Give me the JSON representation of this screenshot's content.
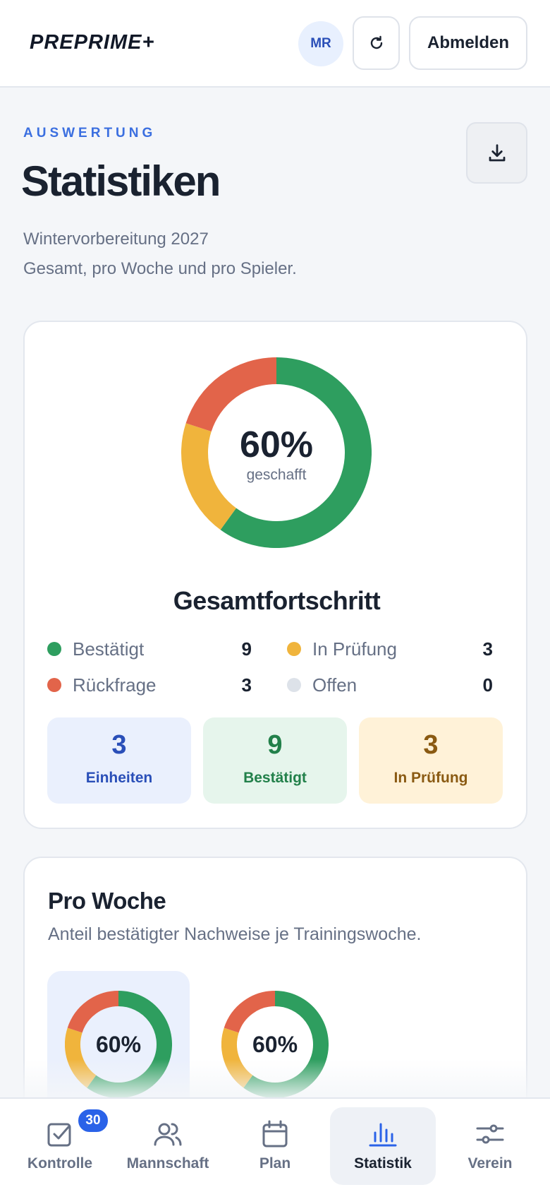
{
  "header": {
    "logo": "PREPRIME+",
    "avatar_initials": "MR",
    "refresh_icon": "refresh-icon",
    "logout_label": "Abmelden"
  },
  "page": {
    "eyebrow": "AUSWERTUNG",
    "title": "Statistiken",
    "subtitle_line1": "Wintervorbereitung 2027",
    "subtitle_line2": "Gesamt, pro Woche und pro Spieler.",
    "download_icon": "download-icon"
  },
  "total": {
    "percent": "60%",
    "percent_label": "geschafft",
    "title": "Gesamtfortschritt",
    "legend": [
      {
        "label": "Bestätigt",
        "count": "9",
        "color": "#2e9e5f"
      },
      {
        "label": "In Prüfung",
        "count": "3",
        "color": "#f0b43c"
      },
      {
        "label": "Rückfrage",
        "count": "3",
        "color": "#e2644a"
      },
      {
        "label": "Offen",
        "count": "0",
        "color": "#dde2e9"
      }
    ],
    "stats": [
      {
        "value": "3",
        "label": "Einheiten",
        "bg": "#eaf0fd",
        "color": "#2a4fb8"
      },
      {
        "value": "9",
        "label": "Bestätigt",
        "bg": "#e6f5ec",
        "color": "#22804a"
      },
      {
        "value": "3",
        "label": "In Prüfung",
        "bg": "#fff2d8",
        "color": "#8a5a12"
      }
    ]
  },
  "chart_data": {
    "type": "pie",
    "categories": [
      "Bestätigt",
      "In Prüfung",
      "Rückfrage",
      "Offen"
    ],
    "values": [
      9,
      3,
      3,
      0
    ],
    "colors": [
      "#2e9e5f",
      "#f0b43c",
      "#e2644a",
      "#dde2e9"
    ],
    "title": "Gesamtfortschritt"
  },
  "weekly": {
    "title": "Pro Woche",
    "description": "Anteil bestätigter Nachweise je Trainingswoche.",
    "weeks": [
      {
        "percent": "60%",
        "values": [
          9,
          3,
          3,
          0
        ]
      },
      {
        "percent": "60%",
        "values": [
          9,
          3,
          3,
          0
        ]
      }
    ]
  },
  "nav": {
    "items": [
      {
        "label": "Kontrolle",
        "icon": "checkbox-icon",
        "badge": "30"
      },
      {
        "label": "Mannschaft",
        "icon": "users-icon"
      },
      {
        "label": "Plan",
        "icon": "calendar-icon"
      },
      {
        "label": "Statistik",
        "icon": "bar-chart-icon"
      },
      {
        "label": "Verein",
        "icon": "sliders-icon"
      }
    ],
    "active": "Statistik"
  }
}
